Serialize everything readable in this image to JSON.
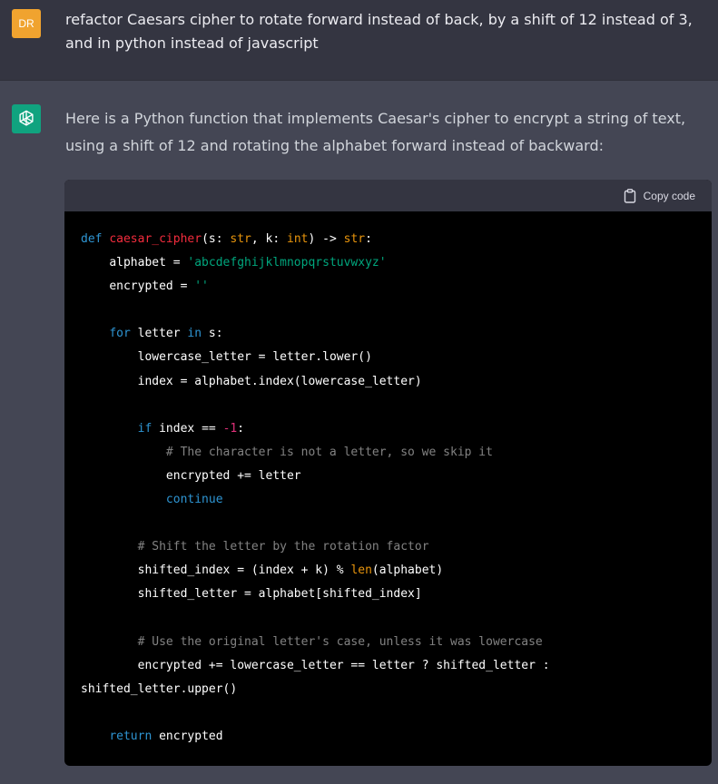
{
  "user_message": {
    "avatar_initials": "DR",
    "text": "refactor Caesars cipher to rotate forward instead of back, by a shift of 12 instead of 3, and in python instead of javascript"
  },
  "assistant_message": {
    "avatar_icon": "openai-logo-icon",
    "intro": "Here is a Python function that implements Caesar's cipher to encrypt a string of text, using a shift of 12 and rotating the alphabet forward instead of backward:",
    "code_block": {
      "copy_label": "Copy code",
      "lines": {
        "l1": {
          "kw": "def",
          "fn": "caesar_cipher",
          "a": "(s: ",
          "ty1": "str",
          "b": ", k: ",
          "ty2": "int",
          "c": ") -> ",
          "ty3": "str",
          "d": ":"
        },
        "l2": {
          "a": "alphabet = ",
          "st": "'abcdefghijklmnopqrstuvwxyz'"
        },
        "l3": {
          "a": "encrypted = ",
          "st": "''"
        },
        "l5": {
          "kw1": "for",
          "a": " letter ",
          "kw2": "in",
          "b": " s:"
        },
        "l6": "lowercase_letter = letter.lower()",
        "l7": "index = alphabet.index(lowercase_letter)",
        "l9": {
          "kw": "if",
          "a": " index == ",
          "nu": "-1",
          "b": ":"
        },
        "l10": "# The character is not a letter, so we skip it",
        "l11": "encrypted += letter",
        "l12": "continue",
        "l14": "# Shift the letter by the rotation factor",
        "l15": {
          "a": "shifted_index = (index + k) % ",
          "ty": "len",
          "b": "(alphabet)"
        },
        "l16": "shifted_letter = alphabet[shifted_index]",
        "l18": "# Use the original letter's case, unless it was lowercase",
        "l19": "encrypted += lowercase_letter == letter ? shifted_letter :",
        "l20": "shifted_letter.upper()",
        "l22": {
          "kw": "return",
          "a": " encrypted"
        }
      }
    }
  },
  "colors": {
    "user_bg": "#343541",
    "assistant_bg": "#444654",
    "user_avatar": "#f0a32f",
    "bot_avatar": "#10a37f",
    "code_bg": "#000000",
    "code_header_bg": "#343541"
  }
}
